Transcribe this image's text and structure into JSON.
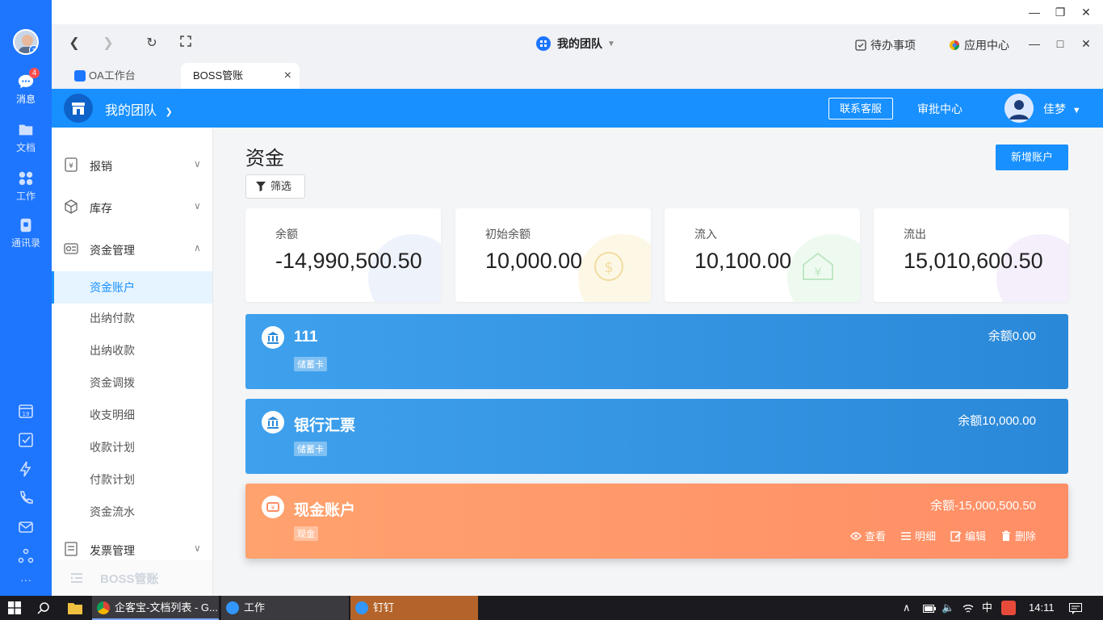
{
  "rail": {
    "items": [
      {
        "label": "消息",
        "badge": "4"
      },
      {
        "label": "文档"
      },
      {
        "label": "工作"
      },
      {
        "label": "通讯录"
      }
    ],
    "more": "···"
  },
  "nav": {
    "team": "我的团队",
    "todo": "待办事项",
    "apps": "应用中心"
  },
  "tabs": [
    {
      "label": "OA工作台"
    },
    {
      "label": "BOSS管账"
    }
  ],
  "header": {
    "title": "我的团队",
    "service": "联系客服",
    "audit": "审批中心",
    "user": "佳梦"
  },
  "side": {
    "groups": [
      {
        "label": "报销"
      },
      {
        "label": "库存"
      },
      {
        "label": "资金管理"
      },
      {
        "label": "发票管理"
      }
    ],
    "subs": [
      "资金账户",
      "出纳付款",
      "出纳收款",
      "资金调拨",
      "收支明细",
      "收款计划",
      "付款计划",
      "资金流水"
    ],
    "footer": "BOSS管账"
  },
  "main": {
    "title": "资金",
    "filter": "筛选",
    "add": "新增账户",
    "stats": [
      {
        "label": "余额",
        "value": "-14,990,500.50"
      },
      {
        "label": "初始余额",
        "value": "10,000.00"
      },
      {
        "label": "流入",
        "value": "10,100.00"
      },
      {
        "label": "流出",
        "value": "15,010,600.50"
      }
    ],
    "accounts": [
      {
        "name": "111",
        "tag": "储蓄卡",
        "balance": "余额0.00"
      },
      {
        "name": "银行汇票",
        "tag": "储蓄卡",
        "balance": "余额10,000.00"
      },
      {
        "name": "现金账户",
        "tag": "现金",
        "balance": "余额-15,000,500.50",
        "actions": [
          "查看",
          "明细",
          "编辑",
          "删除"
        ]
      }
    ]
  },
  "taskbar": {
    "items": [
      "企客宝-文档列表 - G...",
      "工作",
      "钉钉"
    ],
    "ime": "中",
    "clock": "14:11"
  }
}
